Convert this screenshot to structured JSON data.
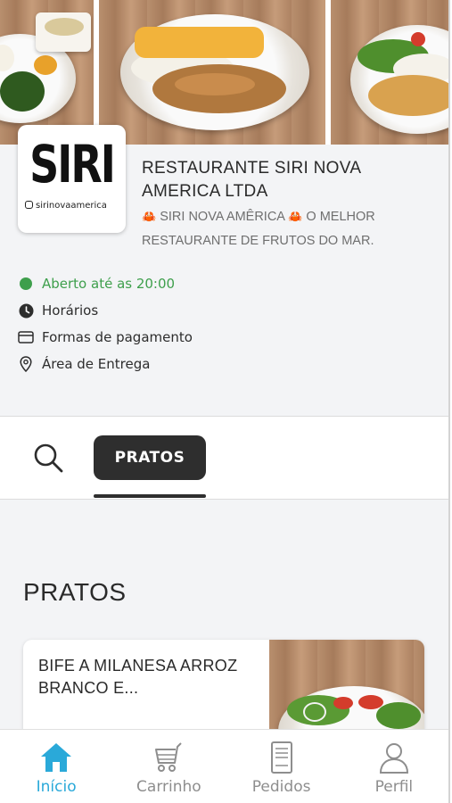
{
  "store": {
    "logo_text": "SIRI",
    "logo_handle": "sirinovaamerica",
    "name": "RESTAURANTE SIRI NOVA AMERICA LTDA",
    "tagline_part1": "SIRI NOVA AMÊRICA",
    "tagline_part2": "O MELHOR RESTAURANTE DE FRUTOS DO MAR.",
    "crab_glyph": "🦀"
  },
  "info": {
    "status": "Aberto até as 20:00",
    "hours": "Horários",
    "payment": "Formas de pagamento",
    "delivery": "Área de Entrega"
  },
  "categories": {
    "tabs": [
      {
        "label": "PRATOS",
        "active": true
      }
    ]
  },
  "section": {
    "title": "PRATOS"
  },
  "products": [
    {
      "name": "BIFE A MILANESA ARROZ BRANCO E..."
    }
  ],
  "nav": {
    "items": [
      {
        "label": "Início",
        "icon": "home-icon",
        "active": true
      },
      {
        "label": "Carrinho",
        "icon": "cart-icon",
        "active": false
      },
      {
        "label": "Pedidos",
        "icon": "orders-icon",
        "active": false
      },
      {
        "label": "Perfil",
        "icon": "profile-icon",
        "active": false
      }
    ]
  },
  "colors": {
    "accent": "#2aa9d9",
    "open_status": "#3e9f4c",
    "pill_bg": "#2e2e2e",
    "crab": "#d9403a"
  }
}
